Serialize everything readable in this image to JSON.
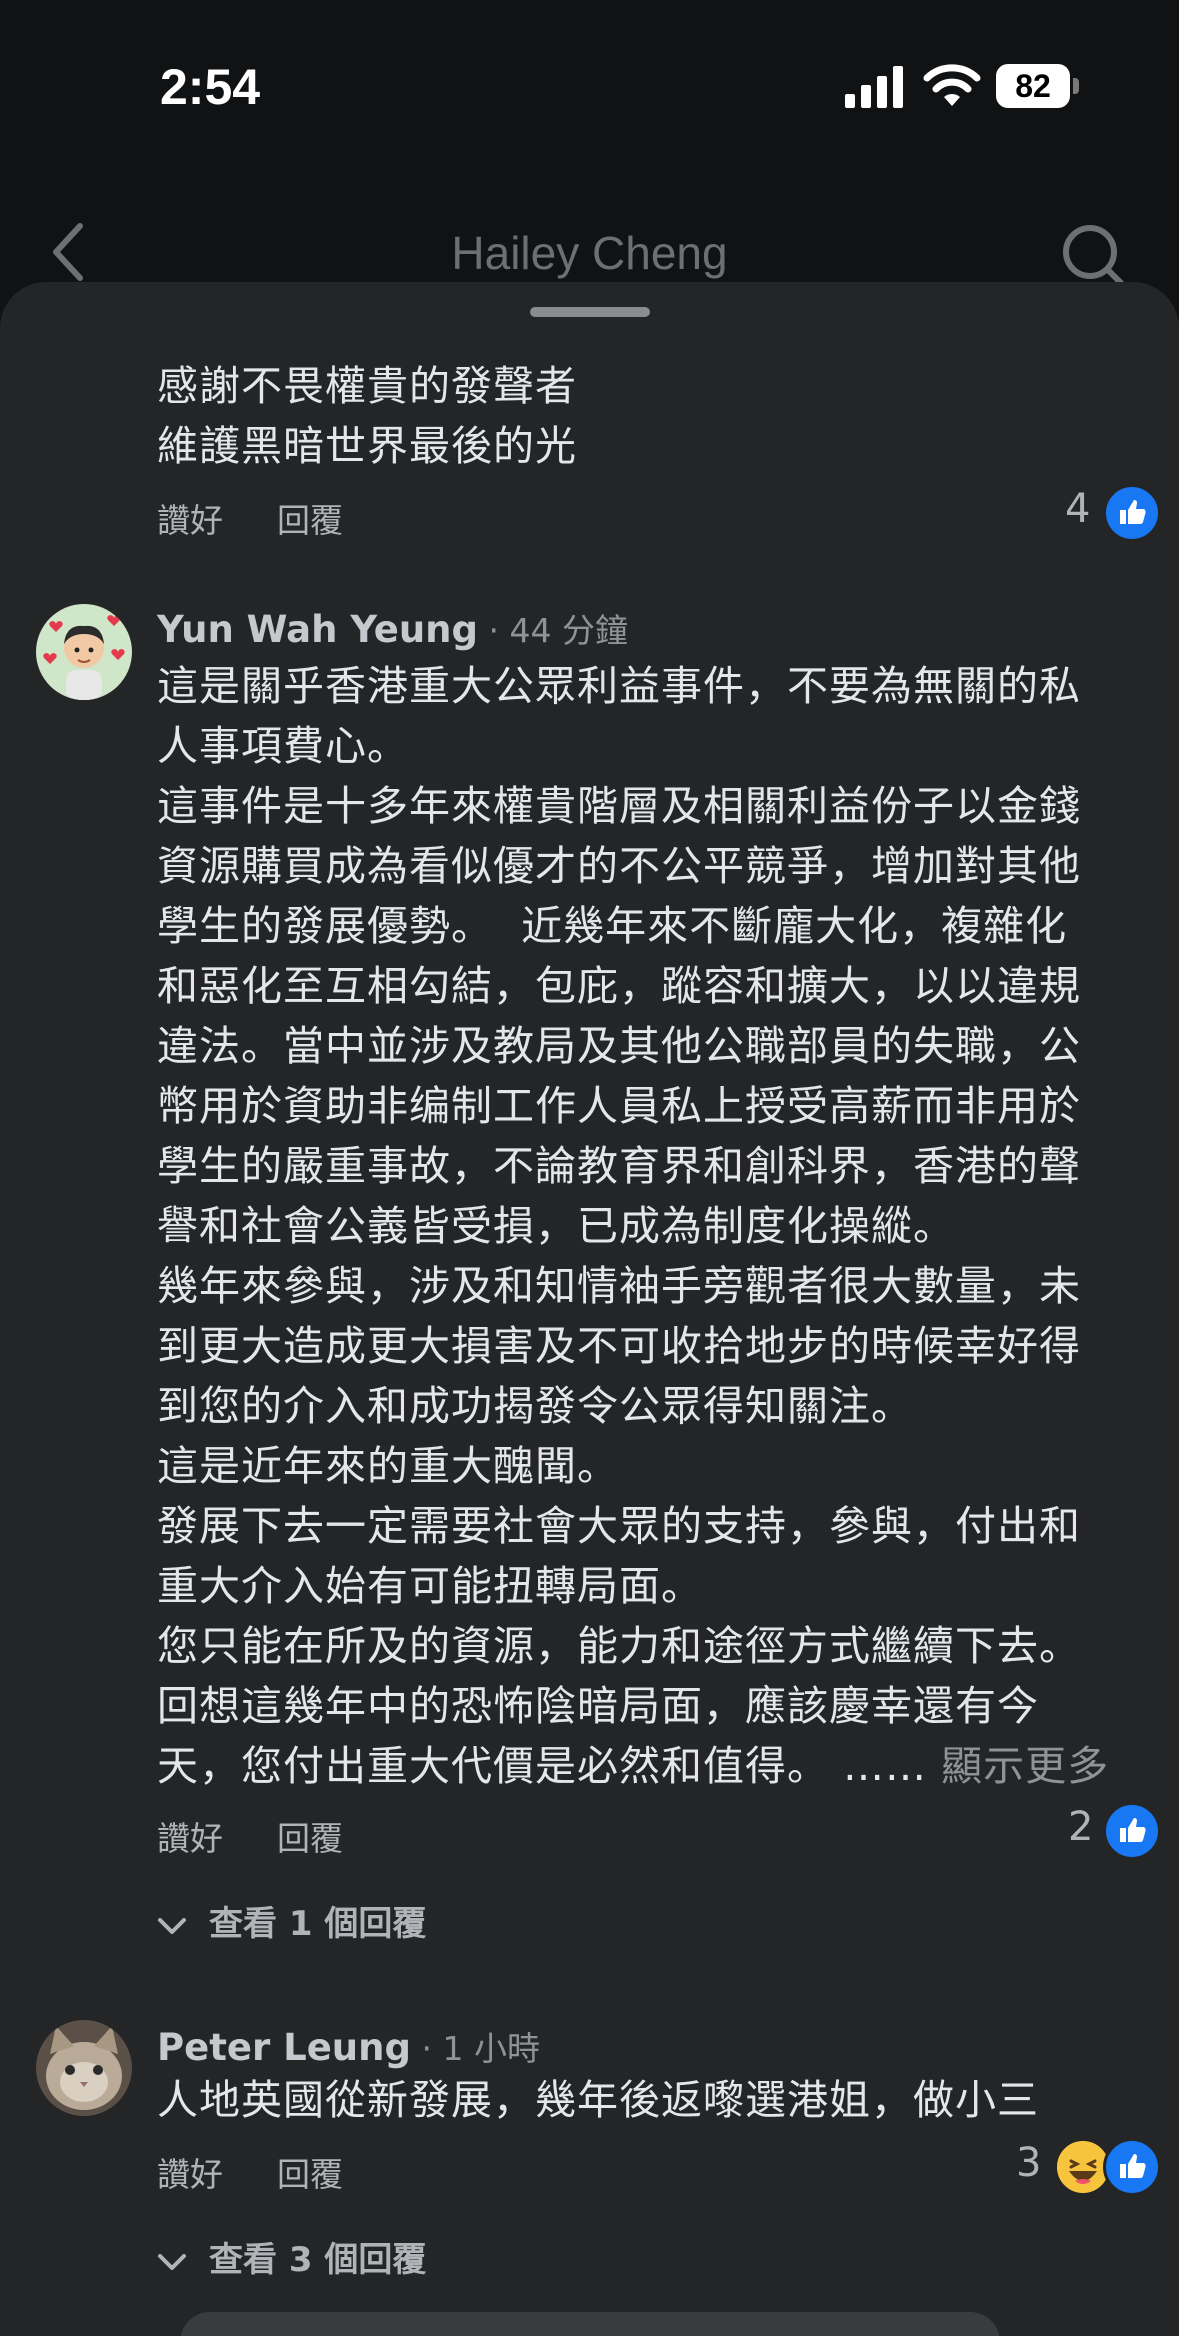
{
  "status": {
    "time": "2:54",
    "battery": "82"
  },
  "header": {
    "title": "Hailey Cheng"
  },
  "actions": {
    "like": "讚好",
    "reply": "回覆"
  },
  "comment_top": {
    "lines": "感謝不畏權貴的發聲者\n維護黑暗世界最後的光",
    "like_count": "4"
  },
  "comment_yun": {
    "author": "Yun Wah Yeung",
    "dot": " · ",
    "time": "44 分鐘",
    "body": "這是關乎香港重大公眾利益事件，不要為無關的私\n人事項費心。\n這事件是十多年來權貴階層及相關利益份子以金錢\n資源購買成為看似優才的不公平競爭，增加對其他\n學生的發展優勢。  近幾年來不斷龐大化，複雜化\n和惡化至互相勾結，包庇，蹤容和擴大，以以違規\n違法。當中並涉及教局及其他公職部員的失職，公\n幣用於資助非编制工作人員私上授受高薪而非用於\n學生的嚴重事故，不論教育界和創科界，香港的聲\n譽和社會公義皆受損，已成為制度化操縱。\n幾年來參與，涉及和知情袖手旁觀者很大數量，未\n到更大造成更大損害及不可收拾地步的時候幸好得\n到您的介入和成功揭發令公眾得知關注。\n這是近年來的重大醜聞。\n發展下去一定需要社會大眾的支持，參與，付出和\n重大介入始有可能扭轉局面。\n您只能在所及的資源，能力和途徑方式繼續下去。\n回想這幾年中的恐怖陰暗局面，應該慶幸還有今\n天，您付出重大代價是必然和值得。 …… ",
    "more": "顯示更多",
    "like_count": "2",
    "view_replies": "查看 1 個回覆"
  },
  "comment_peter": {
    "author": "Peter Leung",
    "dot": " · ",
    "time": "1 小時",
    "body": "人地英國從新發展，幾年後返嚟選港姐，做小三",
    "like_count": "3",
    "view_replies": "查看 3 個回覆"
  },
  "colors": {
    "like_blue": "#1877f2",
    "sheet_bg": "#242526",
    "page_bg": "#111213"
  }
}
